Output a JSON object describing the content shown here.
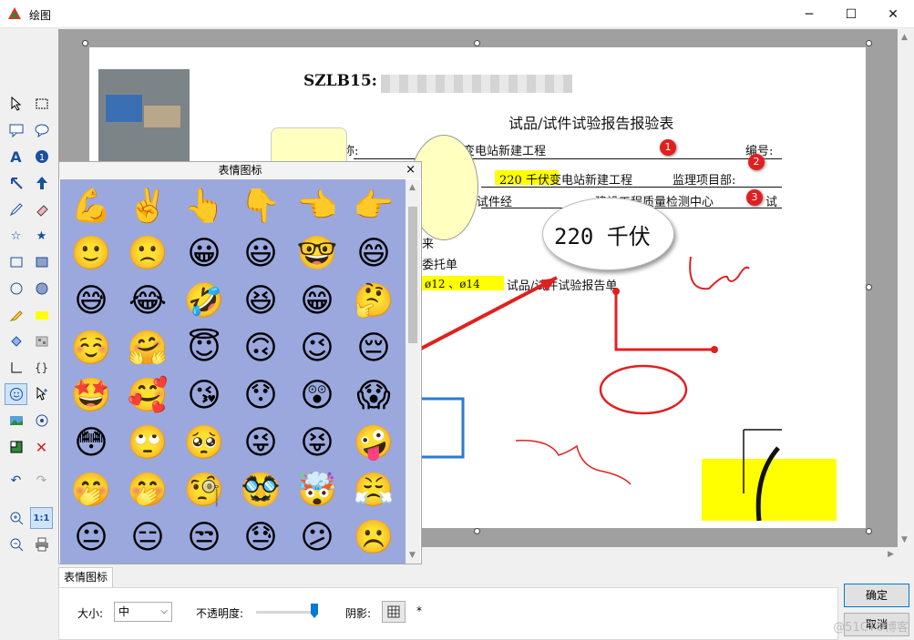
{
  "window": {
    "title": "绘图",
    "minimize_icon": "─",
    "maximize_icon": "☐",
    "close_icon": "✕"
  },
  "document": {
    "code_label": "SZLB15:",
    "title": "试品/试件试验报告报验表",
    "row1_left": "称:",
    "row1_mid": "变电站新建工程",
    "row1_right": "编号:",
    "row2_mid": "220 千伏变电站新建工程",
    "row2_right": "监理项目部:",
    "row3_left": "试件经",
    "row3_mid": "建设工程质量检测中心",
    "row3_right": "试",
    "row4": "来",
    "row5": "委托单",
    "row6_hl": "ø12 、ø14",
    "row6_rest": "试品/试件试验报告单",
    "callout_text": "220 千伏",
    "badges": [
      "1",
      "2",
      "3"
    ]
  },
  "emoji_panel": {
    "title": "表情图标",
    "close_icon": "×",
    "emojis": [
      "💪",
      "✌️",
      "👆",
      "👇",
      "👈",
      "👉",
      "🙂",
      "🙁",
      "😀",
      "😃",
      "🤓",
      "😄",
      "😅",
      "😂",
      "🤣",
      "😆",
      "😁",
      "🤔",
      "☺️",
      "🤗",
      "😇",
      "🙃",
      "😉",
      "😔",
      "🤩",
      "🥰",
      "😘",
      "😯",
      "😲",
      "😱",
      "😳",
      "🙄",
      "🥺",
      "😜",
      "😝",
      "🤪",
      "🤭",
      "🤭",
      "🧐",
      "🥸",
      "🤯",
      "😤",
      "😐",
      "😑",
      "😒",
      "😓",
      "😕",
      "☹️"
    ]
  },
  "toolbar": {
    "zoom_fit_label": "1:1"
  },
  "bottom": {
    "tab_label": "表情图标",
    "size_label": "大小:",
    "size_value": "中",
    "opacity_label": "不透明度:",
    "shadow_label": "阴影:",
    "asterisk": "*",
    "ok_label": "确定",
    "cancel_label": "取消",
    "watermark": "@51CTO博客"
  },
  "colors": {
    "accent": "#0078d7",
    "emoji_bg": "#9aa8de",
    "red": "#e02020",
    "yellow": "#ffff00"
  }
}
